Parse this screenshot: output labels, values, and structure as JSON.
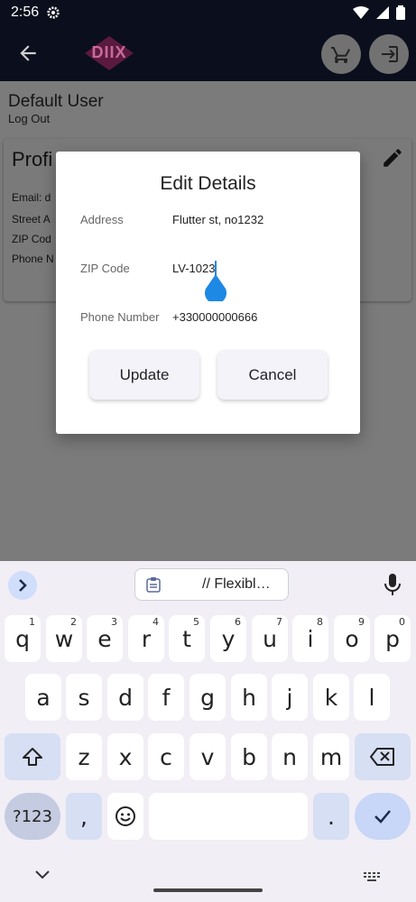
{
  "status_bar": {
    "time": "2:56"
  },
  "app_bar": {
    "logo_text": "DIIX"
  },
  "page": {
    "user_name": "Default User",
    "logout_link": "Log Out",
    "profile_title": "Profi",
    "fields": {
      "email": "Email:  d",
      "street": "Street A",
      "zip": "ZIP Cod",
      "phone": "Phone N"
    }
  },
  "dialog": {
    "title": "Edit Details",
    "address_label": "Address",
    "address_value": "Flutter st, no1232",
    "zip_label": "ZIP Code",
    "zip_value": "LV-1023",
    "phone_label": "Phone Number",
    "phone_value": "+330000000666",
    "update_label": "Update",
    "cancel_label": "Cancel"
  },
  "keyboard": {
    "clipboard_text": "// Flexibl…",
    "row1": [
      {
        "key": "q",
        "num": "1"
      },
      {
        "key": "w",
        "num": "2"
      },
      {
        "key": "e",
        "num": "3"
      },
      {
        "key": "r",
        "num": "4"
      },
      {
        "key": "t",
        "num": "5"
      },
      {
        "key": "y",
        "num": "6"
      },
      {
        "key": "u",
        "num": "7"
      },
      {
        "key": "i",
        "num": "8"
      },
      {
        "key": "o",
        "num": "9"
      },
      {
        "key": "p",
        "num": "0"
      }
    ],
    "row2": [
      "a",
      "s",
      "d",
      "f",
      "g",
      "h",
      "j",
      "k",
      "l"
    ],
    "row3": [
      "z",
      "x",
      "c",
      "v",
      "b",
      "n",
      "m"
    ],
    "symbols_label": "?123",
    "comma": ",",
    "period": "."
  }
}
